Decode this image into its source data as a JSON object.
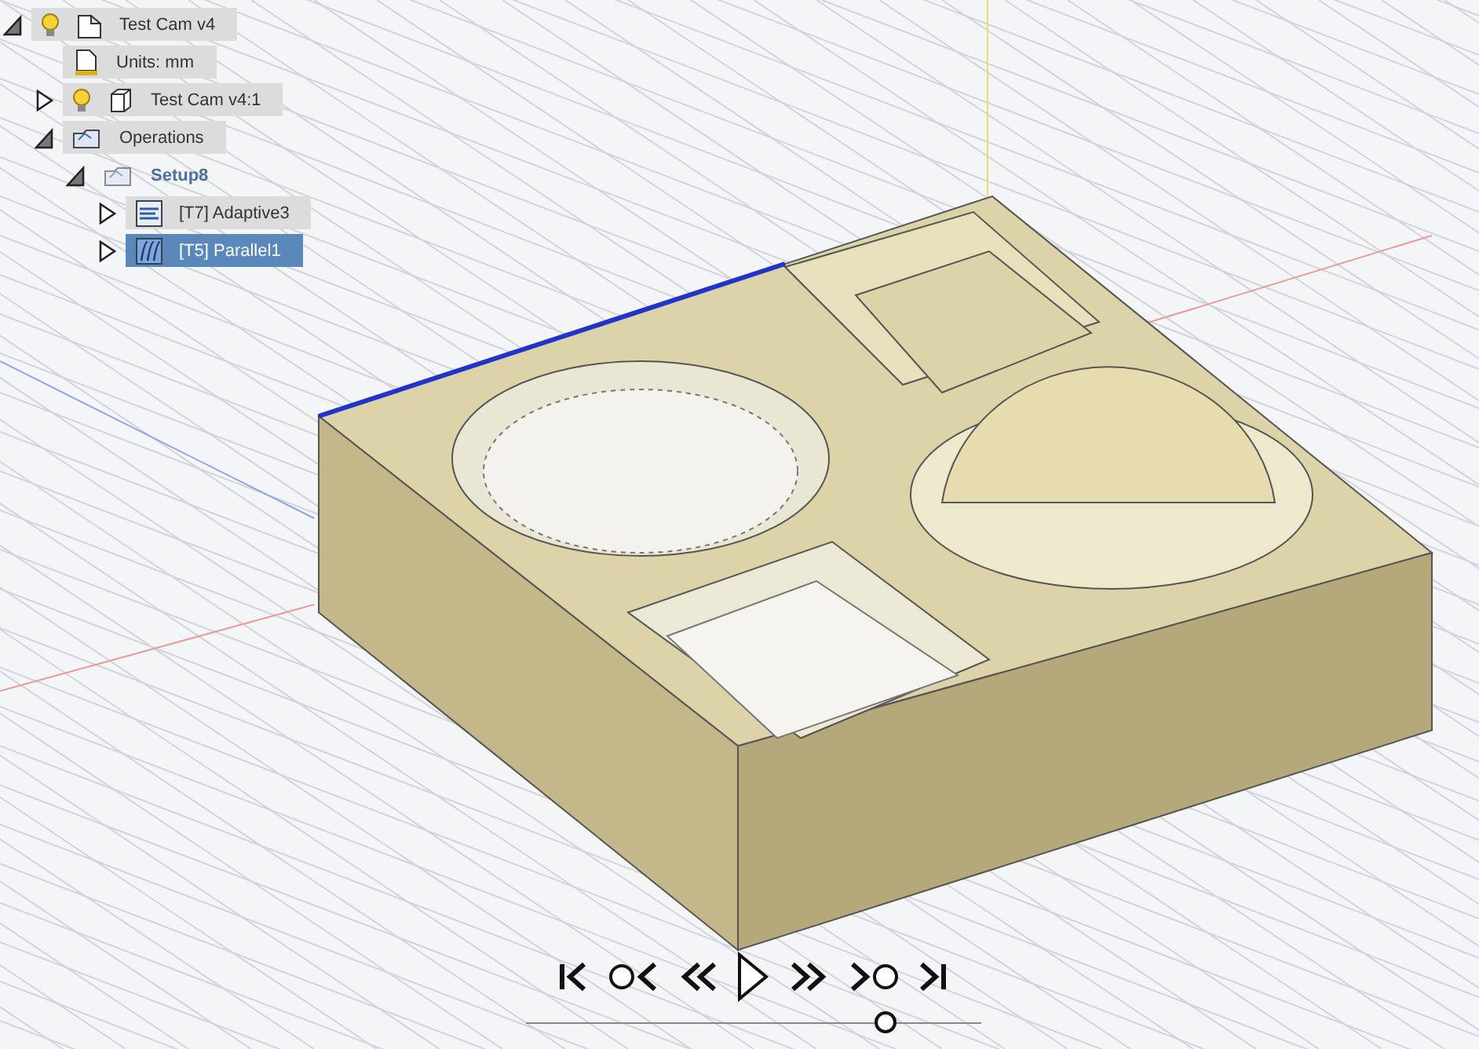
{
  "browser_tree": [
    {
      "label": "Test Cam v4",
      "kind": "document",
      "light": true,
      "expanded": true,
      "selected": false,
      "children": [
        {
          "label": "Units: mm",
          "kind": "units",
          "light": false,
          "selected": false
        },
        {
          "label": "Test Cam v4:1",
          "kind": "component",
          "light": true,
          "expanded": false,
          "selected": false
        },
        {
          "label": "Operations",
          "kind": "operations",
          "light": false,
          "expanded": true,
          "selected": false,
          "children": [
            {
              "label": "Setup8",
              "kind": "setup",
              "light": false,
              "expanded": true,
              "selected": false,
              "children": [
                {
                  "label": "[T7] Adaptive3",
                  "kind": "adaptive",
                  "light": false,
                  "expanded": false,
                  "selected": false
                },
                {
                  "label": "[T5] Parallel1",
                  "kind": "parallel",
                  "light": false,
                  "expanded": false,
                  "selected": true
                }
              ]
            }
          ]
        }
      ]
    }
  ],
  "playback": {
    "buttons": [
      {
        "kind": "first"
      },
      {
        "kind": "previous"
      },
      {
        "kind": "back"
      },
      {
        "kind": "play"
      },
      {
        "kind": "forward"
      },
      {
        "kind": "next"
      },
      {
        "kind": "last"
      }
    ],
    "timeline": {
      "level": 0.79
    }
  }
}
